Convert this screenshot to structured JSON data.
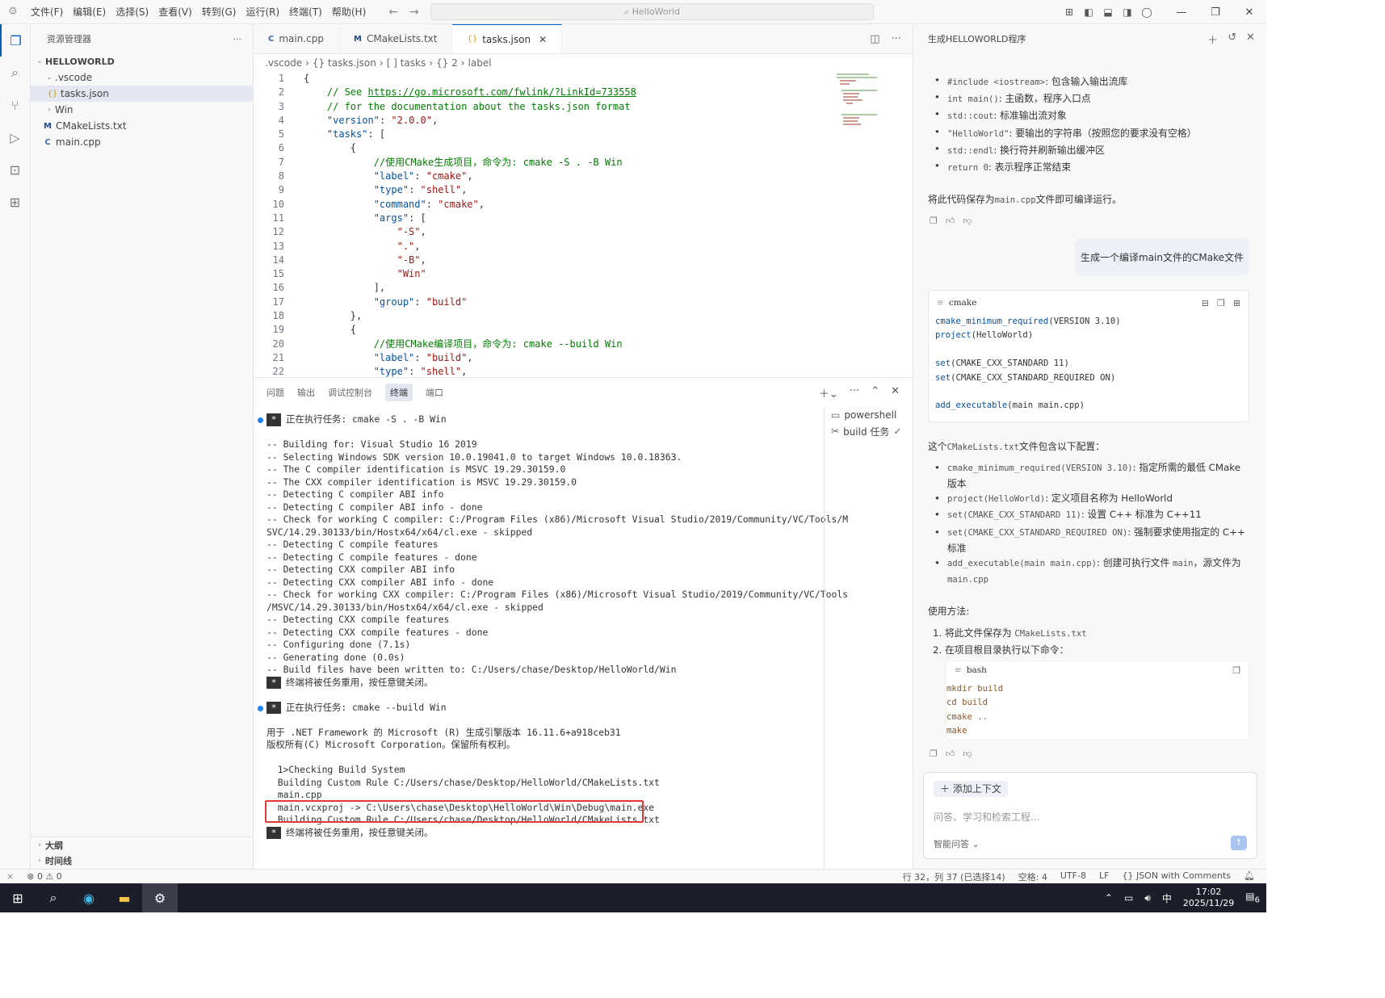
{
  "titlebar": {
    "menu": [
      "文件(F)",
      "编辑(E)",
      "选择(S)",
      "查看(V)",
      "转到(G)",
      "运行(R)",
      "终端(T)",
      "帮助(H)"
    ],
    "search": "HelloWorld"
  },
  "sidebar": {
    "title": "资源管理器",
    "root": "HELLOWORLD",
    "items": [
      {
        "label": ".vscode",
        "type": "folder-open"
      },
      {
        "label": "tasks.json",
        "type": "json"
      },
      {
        "label": "Win",
        "type": "folder"
      },
      {
        "label": "CMakeLists.txt",
        "type": "cmake"
      },
      {
        "label": "main.cpp",
        "type": "cpp"
      }
    ],
    "outline": "大纲",
    "timeline": "时间线"
  },
  "tabs": [
    {
      "label": "main.cpp",
      "icon": "C"
    },
    {
      "label": "CMakeLists.txt",
      "icon": "M"
    },
    {
      "label": "tasks.json",
      "icon": "{}"
    }
  ],
  "breadcrumb": [
    ".vscode",
    "{} tasks.json",
    "[ ] tasks",
    "{} 2",
    "label"
  ],
  "code": [
    {
      "n": "1",
      "t": "{"
    },
    {
      "n": "2",
      "t": "    // See ",
      "url": "https://go.microsoft.com/fwlink/?LinkId=733558"
    },
    {
      "n": "3",
      "t": "    // for the documentation about the tasks.json format"
    },
    {
      "n": "4",
      "t": "    \"version\": \"2.0.0\","
    },
    {
      "n": "5",
      "t": "    \"tasks\": ["
    },
    {
      "n": "6",
      "t": "        {"
    },
    {
      "n": "7",
      "t": "            //使用CMake生成项目，命令为: cmake -S . -B Win"
    },
    {
      "n": "8",
      "t": "            \"label\": \"cmake\","
    },
    {
      "n": "9",
      "t": "            \"type\": \"shell\","
    },
    {
      "n": "10",
      "t": "            \"command\": \"cmake\","
    },
    {
      "n": "11",
      "t": "            \"args\": ["
    },
    {
      "n": "12",
      "t": "                \"-S\","
    },
    {
      "n": "13",
      "t": "                \".\","
    },
    {
      "n": "14",
      "t": "                \"-B\","
    },
    {
      "n": "15",
      "t": "                \"Win\""
    },
    {
      "n": "16",
      "t": "            ],"
    },
    {
      "n": "17",
      "t": "            \"group\": \"build\""
    },
    {
      "n": "18",
      "t": "        },"
    },
    {
      "n": "19",
      "t": "        {"
    },
    {
      "n": "20",
      "t": "            //使用CMake编译项目，命令为: cmake --build Win"
    },
    {
      "n": "21",
      "t": "            \"label\": \"build\","
    },
    {
      "n": "22",
      "t": "            \"type\": \"shell\","
    }
  ],
  "panel": {
    "tabs": [
      "问题",
      "输出",
      "调试控制台",
      "终端",
      "端口"
    ],
    "active": "终端"
  },
  "terminal": [
    {
      "star": true,
      "dot": true,
      "t": "正在执行任务: cmake -S . -B Win"
    },
    {
      "t": ""
    },
    {
      "t": "-- Building for: Visual Studio 16 2019"
    },
    {
      "t": "-- Selecting Windows SDK version 10.0.19041.0 to target Windows 10.0.18363."
    },
    {
      "t": "-- The C compiler identification is MSVC 19.29.30159.0"
    },
    {
      "t": "-- The CXX compiler identification is MSVC 19.29.30159.0"
    },
    {
      "t": "-- Detecting C compiler ABI info"
    },
    {
      "t": "-- Detecting C compiler ABI info - done"
    },
    {
      "t": "-- Check for working C compiler: C:/Program Files (x86)/Microsoft Visual Studio/2019/Community/VC/Tools/M"
    },
    {
      "t": "SVC/14.29.30133/bin/Hostx64/x64/cl.exe - skipped"
    },
    {
      "t": "-- Detecting C compile features"
    },
    {
      "t": "-- Detecting C compile features - done"
    },
    {
      "t": "-- Detecting CXX compiler ABI info"
    },
    {
      "t": "-- Detecting CXX compiler ABI info - done"
    },
    {
      "t": "-- Check for working CXX compiler: C:/Program Files (x86)/Microsoft Visual Studio/2019/Community/VC/Tools"
    },
    {
      "t": "/MSVC/14.29.30133/bin/Hostx64/x64/cl.exe - skipped"
    },
    {
      "t": "-- Detecting CXX compile features"
    },
    {
      "t": "-- Detecting CXX compile features - done"
    },
    {
      "t": "-- Configuring done (7.1s)"
    },
    {
      "t": "-- Generating done (0.0s)"
    },
    {
      "t": "-- Build files have been written to: C:/Users/chase/Desktop/HelloWorld/Win"
    },
    {
      "star": true,
      "t": "终端将被任务重用，按任意键关闭。"
    },
    {
      "t": ""
    },
    {
      "star": true,
      "dot": true,
      "t": "正在执行任务: cmake --build Win"
    },
    {
      "t": ""
    },
    {
      "t": "用于 .NET Framework 的 Microsoft (R) 生成引擎版本 16.11.6+a918ceb31"
    },
    {
      "t": "版权所有(C) Microsoft Corporation。保留所有权利。"
    },
    {
      "t": ""
    },
    {
      "t": "  1>Checking Build System"
    },
    {
      "t": "  Building Custom Rule C:/Users/chase/Desktop/HelloWorld/CMakeLists.txt"
    },
    {
      "t": "  main.cpp"
    },
    {
      "t": "  main.vcxproj -> C:\\Users\\chase\\Desktop\\HelloWorld\\Win\\Debug\\main.exe"
    },
    {
      "t": "  Building Custom Rule C:/Users/chase/Desktop/HelloWorld/CMakeLists.txt"
    },
    {
      "star": true,
      "t": "终端将被任务重用，按任意键关闭。"
    }
  ],
  "terminal_list": [
    "powershell",
    "build 任务"
  ],
  "chat": {
    "title": "生成HELLOWORLD程序",
    "bullets1": [
      {
        "c": "#include <iostream>",
        "t": ": 包含输入输出流库"
      },
      {
        "c": "int main()",
        "t": ": 主函数，程序入口点"
      },
      {
        "c": "std::cout",
        "t": ": 标准输出流对象"
      },
      {
        "c": "\"HelloWorld\"",
        "t": ": 要输出的字符串（按照您的要求没有空格）"
      },
      {
        "c": "std::endl",
        "t": ": 换行符并刷新输出缓冲区"
      },
      {
        "c": "return 0",
        "t": ": 表示程序正常结束"
      }
    ],
    "save_note_a": "将此代码保存为",
    "save_note_code": "main.cpp",
    "save_note_b": "文件即可编译运行。",
    "user_msg": "生成一个编译main文件的CMake文件",
    "cmake_lang": "cmake",
    "cmake_lines": [
      {
        "f": "cmake_minimum_required",
        "r": "(VERSION 3.10)"
      },
      {
        "f": "project",
        "r": "(HelloWorld)"
      },
      {
        "f": "",
        "r": ""
      },
      {
        "f": "set",
        "r": "(CMAKE_CXX_STANDARD 11)"
      },
      {
        "f": "set",
        "r": "(CMAKE_CXX_STANDARD_REQUIRED ON)"
      },
      {
        "f": "",
        "r": ""
      },
      {
        "f": "add_executable",
        "r": "(main main.cpp)"
      }
    ],
    "cfg_intro_a": "这个",
    "cfg_intro_code": "CMakeLists.txt",
    "cfg_intro_b": "文件包含以下配置：",
    "bullets2": [
      {
        "c": "cmake_minimum_required(VERSION 3.10)",
        "t": ": 指定所需的最低 CMake",
        "t2": "版本"
      },
      {
        "c": "project(HelloWorld)",
        "t": ": 定义项目名称为 HelloWorld",
        "t2": ""
      },
      {
        "c": "set(CMAKE_CXX_STANDARD 11)",
        "t": ": 设置 C++ 标准为 C++11",
        "t2": ""
      },
      {
        "c": "set(CMAKE_CXX_STANDARD_REQUIRED ON)",
        "t": ": 强制要求使用指定的 C++",
        "t2": "标准"
      },
      {
        "c": "add_executable(main main.cpp)",
        "t": ": 创建可执行文件 ",
        "c2": "main",
        "t3": "，源文件为",
        "c3": "main.cpp"
      }
    ],
    "usage": "使用方法:",
    "step1a": "1. 将此文件保存为 ",
    "step1code": "CMakeLists.txt",
    "step2": "2. 在项目根目录执行以下命令：",
    "bash_lang": "bash",
    "bash_lines": [
      "mkdir build",
      "cd build",
      "cmake ..",
      "make"
    ],
    "add_context": "添加上下文",
    "placeholder": "问答、学习和检索工程...",
    "mode": "智能问答"
  },
  "status": {
    "errors": "0",
    "warnings": "0",
    "position": "行 32，列 37 (已选择14)",
    "spaces": "空格: 4",
    "encoding": "UTF-8",
    "eol": "LF",
    "language": "JSON with Comments"
  },
  "taskbar": {
    "time": "17:02",
    "date": "2025/11/29",
    "ime": "中",
    "notif": "6"
  }
}
